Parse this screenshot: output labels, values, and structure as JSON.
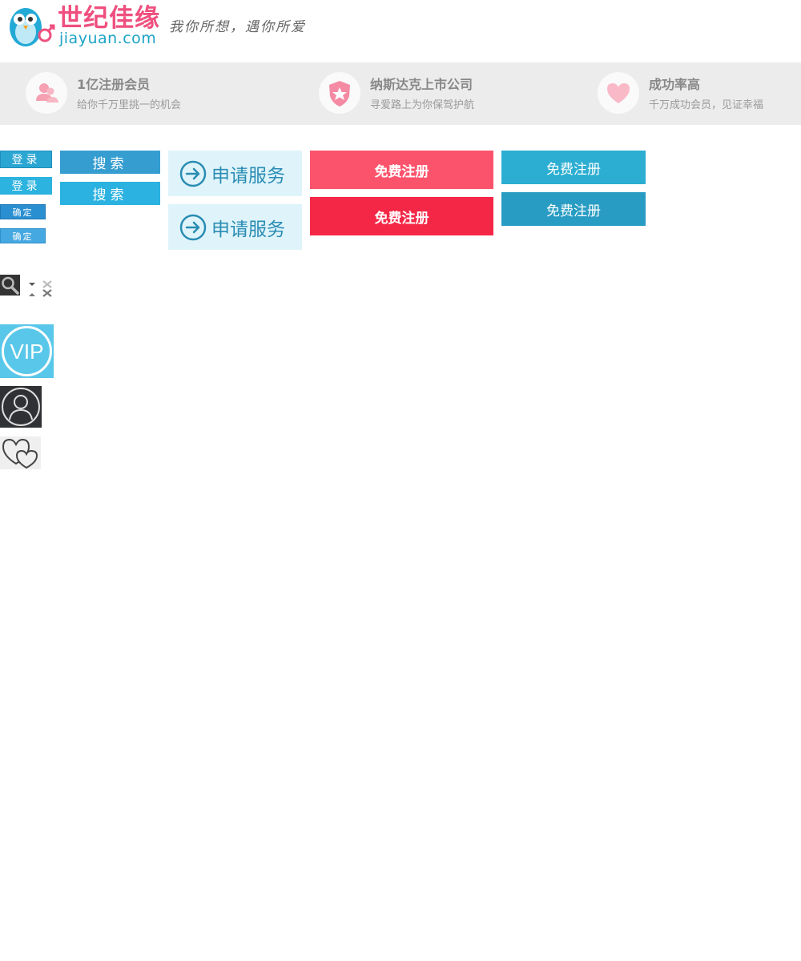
{
  "header": {
    "logo_cn": "世纪佳缘",
    "logo_en": "jiayuan.com",
    "slogan": "我你所想，遇你所爱"
  },
  "features": [
    {
      "title": "1亿注册会员",
      "desc": "给你千万里挑一的机会",
      "icon": "users-icon"
    },
    {
      "title": "纳斯达克上市公司",
      "desc": "寻爱路上为你保驾护航",
      "icon": "shield-star-icon"
    },
    {
      "title": "成功率高",
      "desc": "千万成功会员，见证幸福",
      "icon": "heart-icon"
    }
  ],
  "buttons": {
    "login_1": "登录",
    "login_2": "登录",
    "confirm_1": "确定",
    "confirm_2": "确定",
    "search_1": "搜索",
    "search_2": "搜索",
    "apply_1": "申请服务",
    "apply_2": "申请服务",
    "register_pink_1": "免费注册",
    "register_pink_2": "免费注册",
    "register_blue_1": "免费注册",
    "register_blue_2": "免费注册"
  },
  "icons": [
    "search-icon",
    "caret-down-icon",
    "caret-up-icon",
    "close-icon",
    "vip-icon",
    "user-icon",
    "hearts-icon"
  ],
  "colors": {
    "brand_pink": "#ef4f7e",
    "brand_blue": "#1ba3c6",
    "feature_bg": "#ececec",
    "register_pink": "#fc536c",
    "register_pink_hover": "#f52746",
    "register_blue": "#2caed2",
    "register_blue_hover": "#289cc3"
  }
}
